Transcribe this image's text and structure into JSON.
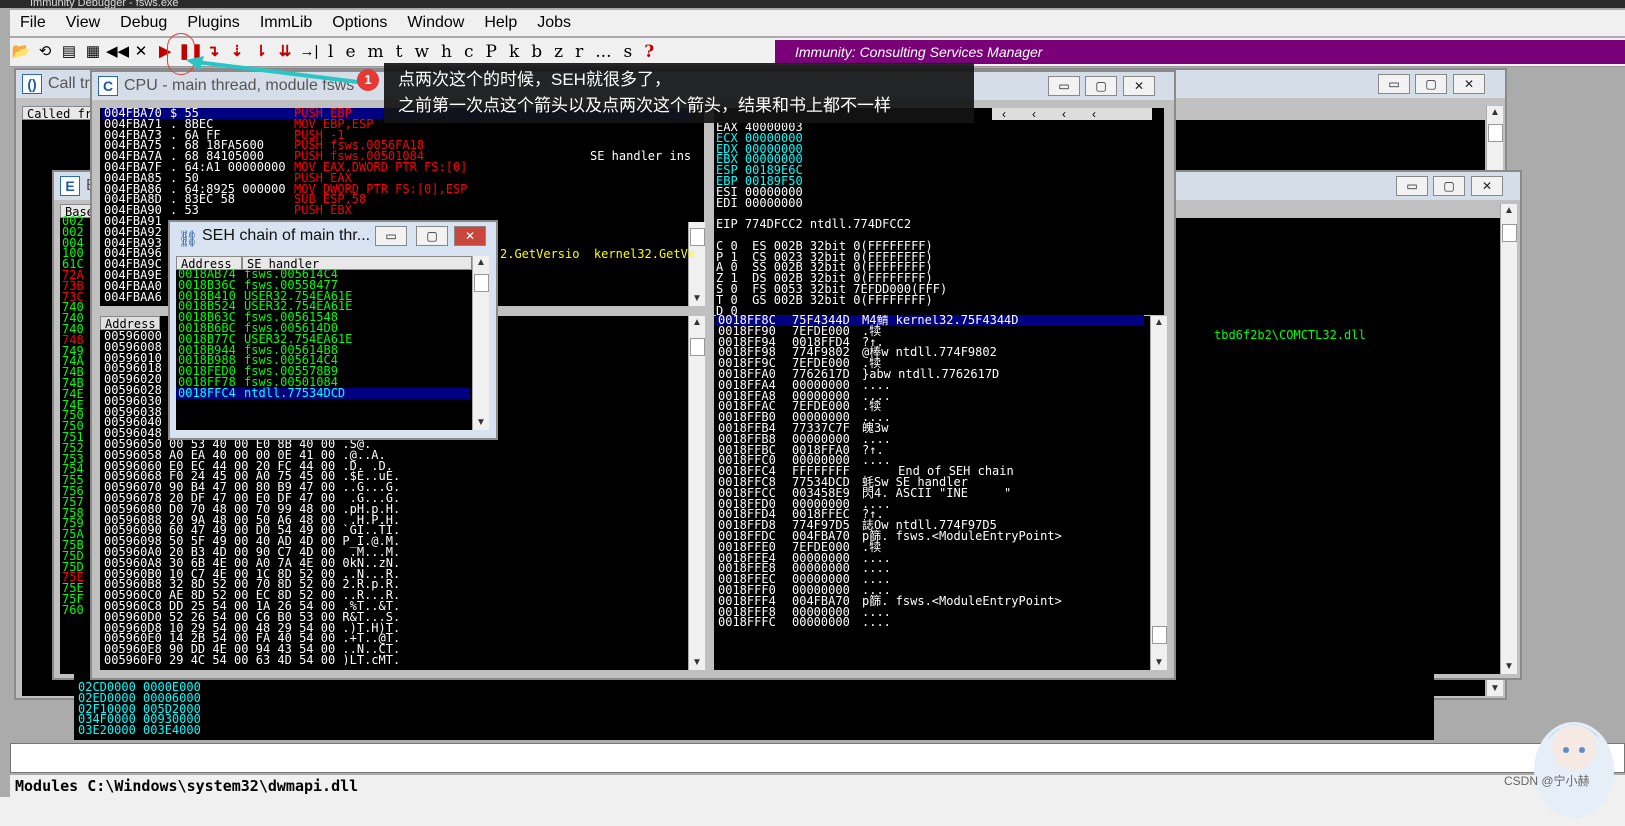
{
  "app": {
    "title": "Immunity Debugger - fsws.exe"
  },
  "menu": [
    "File",
    "View",
    "Debug",
    "Plugins",
    "ImmLib",
    "Options",
    "Window",
    "Help",
    "Jobs"
  ],
  "toolbar": {
    "letters": [
      "l",
      "e",
      "m",
      "t",
      "w",
      "h",
      "c",
      "P",
      "k",
      "b",
      "z",
      "r",
      "...",
      "s",
      "?"
    ],
    "brand": "Immunity: Consulting Services Manager"
  },
  "annotation": {
    "badge": "1",
    "line1": "点两次这个的时候，SEH就很多了，",
    "line2": "之前第一次点这个箭头以及点两次这个箭头，结果和书上都不一样"
  },
  "callstack": {
    "letter": "()",
    "title": "Call tr",
    "header": "Called fr"
  },
  "exe_win": {
    "letter": "E",
    "title": "E",
    "header": "Base"
  },
  "cpu": {
    "letter": "C",
    "title": "CPU - main thread, module fsws",
    "comment1": "SE handler ins",
    "comment2": "2.GetVersio  kernel32.GetVe",
    "disasm": [
      {
        "addr": "004FBA70",
        "bytes": "$ 55",
        "instr": "PUSH EBP"
      },
      {
        "addr": "004FBA71",
        "bytes": ". 8BEC",
        "instr": "MOV EBP,ESP"
      },
      {
        "addr": "004FBA73",
        "bytes": ". 6A FF",
        "instr": "PUSH -1"
      },
      {
        "addr": "004FBA75",
        "bytes": ". 68 18FA5600",
        "instr": "PUSH fsws.0056FA18"
      },
      {
        "addr": "004FBA7A",
        "bytes": ". 68 84105000",
        "instr": "PUSH fsws.00501084"
      },
      {
        "addr": "004FBA7F",
        "bytes": ". 64:A1 00000000",
        "instr": "MOV EAX,DWORD PTR FS:[0]"
      },
      {
        "addr": "004FBA85",
        "bytes": ". 50",
        "instr": "PUSH EAX"
      },
      {
        "addr": "004FBA86",
        "bytes": ". 64:8925 000000",
        "instr": "MOV DWORD PTR FS:[0],ESP"
      },
      {
        "addr": "004FBA8D",
        "bytes": ". 83EC 58",
        "instr": "SUB ESP,58"
      },
      {
        "addr": "004FBA90",
        "bytes": ". 53",
        "instr": "PUSH EBX"
      },
      {
        "addr": "004FBA91",
        "bytes": "",
        "instr": ""
      },
      {
        "addr": "004FBA92",
        "bytes": "",
        "instr": ""
      },
      {
        "addr": "004FBA93",
        "bytes": "",
        "instr": ""
      },
      {
        "addr": "004FBA96",
        "bytes": "",
        "instr": ""
      },
      {
        "addr": "004FBA9C",
        "bytes": "",
        "instr": ""
      },
      {
        "addr": "004FBA9E",
        "bytes": "",
        "instr": ""
      },
      {
        "addr": "004FBAA0",
        "bytes": "",
        "instr": ""
      },
      {
        "addr": "004FBAA6",
        "bytes": "",
        "instr": ""
      }
    ],
    "registers": [
      "EAX 40000003",
      "ECX 00000000",
      "EDX 00000000",
      "EBX 00000000",
      "ESP 00189E6C",
      "EBP 00189F50",
      "ESI 00000000",
      "EDI 00000000",
      "",
      "EIP 774DFCC2 ntdll.774DFCC2",
      "",
      "C 0  ES 002B 32bit 0(FFFFFFFF)",
      "P 1  CS 0023 32bit 0(FFFFFFFF)",
      "A 0  SS 002B 32bit 0(FFFFFFFF)",
      "Z 1  DS 002B 32bit 0(FFFFFFFF)",
      "S 0  FS 0053 32bit 7EFDD000(FFF)",
      "T 0  GS 002B 32bit 0(FFFFFFFF)",
      "D 0"
    ],
    "dump_header": "Address",
    "dump": [
      "00596000",
      "00596008",
      "00596010",
      "00596018",
      "00596020",
      "00596028",
      "00596030",
      "00596038",
      "00596040",
      "00596048",
      "00596050 00 53 40 00 E0 8B 40 00 .S@.",
      "00596058 A0 EA 40 00 00 0E 41 00 .@..A.",
      "00596060 E0 EC 44 00 20 FC 44 00 .D. .D.",
      "00596068 F0 24 45 00 A0 75 45 00 .$E..uE.",
      "00596070 90 B4 47 00 80 B9 47 00 ..G...G.",
      "00596078 20 DF 47 00 E0 DF 47 00  .G...G.",
      "00596080 D0 70 48 00 70 99 48 00 .pH.p.H.",
      "00596088 20 9A 48 00 50 A6 48 00  .H.P.H.",
      "00596090 60 47 49 00 D0 54 49 00 `GI..TI.",
      "00596098 50 5F 49 00 40 AD 4D 00 P_I.@.M.",
      "005960A0 20 B3 4D 00 90 C7 4D 00  .M...M.",
      "005960A8 30 6B 4E 00 A0 7A 4E 00 0kN..zN.",
      "005960B0 10 C7 4E 00 1C 8D 52 00 ..N...R.",
      "005960B8 32 8D 52 00 70 8D 52 00 2.R.p.R.",
      "005960C0 AE 8D 52 00 EC 8D 52 00 ..R...R.",
      "005960C8 DD 25 54 00 1A 26 54 00 .%T..&T.",
      "005960D0 52 26 54 00 C6 B0 53 00 R&T...S.",
      "005960D8 10 29 54 00 48 29 54 00 .)T.H)T.",
      "005960E0 14 2B 54 00 FA 40 54 00 .+T..@T.",
      "005960E8 90 DD 4E 00 94 43 54 00 ..N..CT.",
      "005960F0 29 4C 54 00 63 4D 54 00 )LT.cMT."
    ],
    "stack": [
      {
        "addr": "0018FF8C",
        "val": "75F4344D",
        "comment": "M4鯖 kernel32.75F4344D"
      },
      {
        "addr": "0018FF90",
        "val": "7EFDE000",
        "comment": ".犊"
      },
      {
        "addr": "0018FF94",
        "val": "0018FFD4",
        "comment": "?↑."
      },
      {
        "addr": "0018FF98",
        "val": "774F9802",
        "comment": "@棒w ntdll.774F9802"
      },
      {
        "addr": "0018FF9C",
        "val": "7EFDE000",
        "comment": ".犊"
      },
      {
        "addr": "0018FFA0",
        "val": "7762617D",
        "comment": "}abw ntdll.7762617D"
      },
      {
        "addr": "0018FFA4",
        "val": "00000000",
        "comment": "...."
      },
      {
        "addr": "0018FFA8",
        "val": "00000000",
        "comment": "...."
      },
      {
        "addr": "0018FFAC",
        "val": "7EFDE000",
        "comment": ".犊"
      },
      {
        "addr": "0018FFB0",
        "val": "00000000",
        "comment": "...."
      },
      {
        "addr": "0018FFB4",
        "val": "77337C7F",
        "comment": "魄3w"
      },
      {
        "addr": "0018FFB8",
        "val": "00000000",
        "comment": "...."
      },
      {
        "addr": "0018FFBC",
        "val": "0018FFA0",
        "comment": "?↑."
      },
      {
        "addr": "0018FFC0",
        "val": "00000000",
        "comment": "...."
      },
      {
        "addr": "0018FFC4",
        "val": "FFFFFFFF",
        "comment": "     End of SEH chain"
      },
      {
        "addr": "0018FFC8",
        "val": "77534DCD",
        "comment": "蚝Sw SE handler"
      },
      {
        "addr": "0018FFCC",
        "val": "003458E9",
        "comment": "閃4. ASCII \"INE     \""
      },
      {
        "addr": "0018FFD0",
        "val": "00000000",
        "comment": "...."
      },
      {
        "addr": "0018FFD4",
        "val": "0018FFEC",
        "comment": "?↑."
      },
      {
        "addr": "0018FFD8",
        "val": "774F97D5",
        "comment": "誌Ow ntdll.774F97D5"
      },
      {
        "addr": "0018FFDC",
        "val": "004FBA70",
        "comment": "p篩. fsws.<ModuleEntryPoint>"
      },
      {
        "addr": "0018FFE0",
        "val": "7EFDE000",
        "comment": ".犊"
      },
      {
        "addr": "0018FFE4",
        "val": "00000000",
        "comment": "...."
      },
      {
        "addr": "0018FFE8",
        "val": "00000000",
        "comment": "...."
      },
      {
        "addr": "0018FFEC",
        "val": "00000000",
        "comment": "...."
      },
      {
        "addr": "0018FFF0",
        "val": "00000000",
        "comment": "...."
      },
      {
        "addr": "0018FFF4",
        "val": "004FBA70",
        "comment": "p篩. fsws.<ModuleEntryPoint>"
      },
      {
        "addr": "0018FFF8",
        "val": "00000000",
        "comment": "...."
      },
      {
        "addr": "0018FFFC",
        "val": "00000000",
        "comment": "...."
      }
    ]
  },
  "seh": {
    "title": "SEH chain of main thr...",
    "col_address": "Address",
    "col_handler": "SE handler",
    "rows": [
      {
        "addr": "0018AB74",
        "handler": "fsws.005614C4"
      },
      {
        "addr": "0018B36C",
        "handler": "fsws.00558477"
      },
      {
        "addr": "0018B410",
        "handler": "USER32.754EA61E"
      },
      {
        "addr": "0018B524",
        "handler": "USER32.754EA61E"
      },
      {
        "addr": "0018B63C",
        "handler": "fsws.00561548"
      },
      {
        "addr": "0018B6BC",
        "handler": "fsws.005614D0"
      },
      {
        "addr": "0018B77C",
        "handler": "USER32.754EA61E"
      },
      {
        "addr": "0018B944",
        "handler": "fsws.005614B8"
      },
      {
        "addr": "0018B988",
        "handler": "fsws.005614C4"
      },
      {
        "addr": "0018FED0",
        "handler": "fsws.005578B9"
      },
      {
        "addr": "0018FF78",
        "handler": "fsws.00501084"
      },
      {
        "addr": "0018FFC4",
        "handler": "ntdll.77534DCD"
      }
    ]
  },
  "memmap": {
    "path": "tbd6f2b2\\COMCTL32.dll",
    "rows": [
      "02CD0000 0000E000",
      "02ED0000 00006000",
      "02F10000 005D2000",
      "034F0000 00930000",
      "03E20000 003E4000"
    ]
  },
  "exe_left_col": [
    "002",
    "002",
    "004",
    "100",
    "61C",
    "72A",
    "73B",
    "73C",
    "740",
    "740",
    "740",
    "748",
    "749",
    "74A",
    "74B",
    "74B",
    "74E",
    "74E",
    "750",
    "750",
    "751",
    "752",
    "753",
    "754",
    "755",
    "756",
    "757",
    "758",
    "759",
    "75A",
    "75B",
    "75D",
    "75D",
    "75E",
    "75E",
    "75F",
    "760"
  ],
  "status": "Modules C:\\Windows\\system32\\dwmapi.dll",
  "watermark": "CSDN @宁小赫"
}
